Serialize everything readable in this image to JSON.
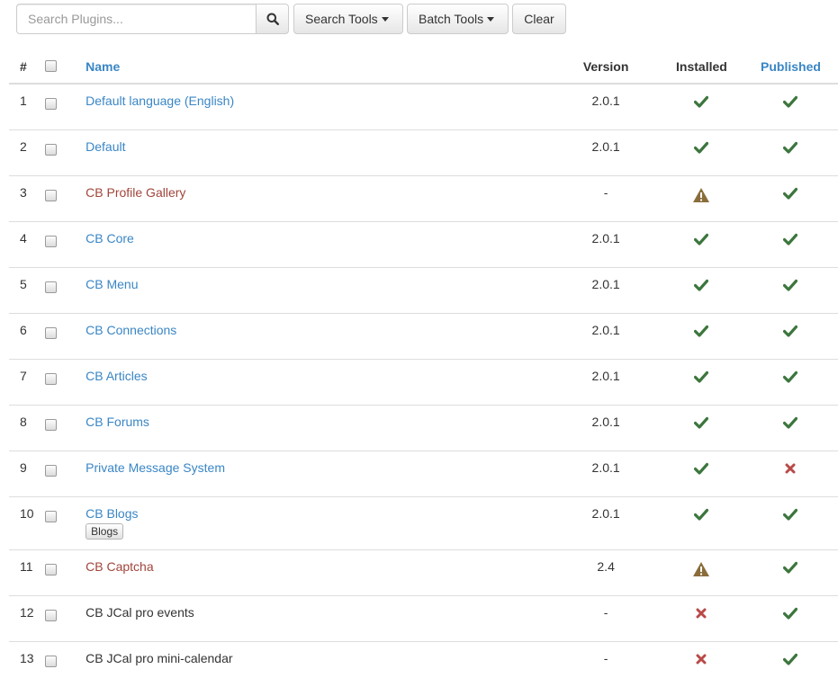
{
  "toolbar": {
    "search_placeholder": "Search Plugins...",
    "search_tools_label": "Search Tools",
    "batch_tools_label": "Batch Tools",
    "clear_label": "Clear"
  },
  "columns": {
    "num": "#",
    "name": "Name",
    "version": "Version",
    "installed": "Installed",
    "published": "Published"
  },
  "colors": {
    "link": "#3a86c5",
    "link_warning": "#a1453b",
    "check": "#3c763d",
    "cross": "#b94a48",
    "warning": "#8a6d3b"
  },
  "rows": [
    {
      "num": "1",
      "name": "Default language (English)",
      "name_style": "blue",
      "version": "2.0.1",
      "installed": "check",
      "published": "check"
    },
    {
      "num": "2",
      "name": "Default",
      "name_style": "blue",
      "version": "2.0.1",
      "installed": "check",
      "published": "check"
    },
    {
      "num": "3",
      "name": "CB Profile Gallery",
      "name_style": "red",
      "version": "-",
      "installed": "warning",
      "published": "check"
    },
    {
      "num": "4",
      "name": "CB Core",
      "name_style": "blue",
      "version": "2.0.1",
      "installed": "check",
      "published": "check"
    },
    {
      "num": "5",
      "name": "CB Menu",
      "name_style": "blue",
      "version": "2.0.1",
      "installed": "check",
      "published": "check"
    },
    {
      "num": "6",
      "name": "CB Connections",
      "name_style": "blue",
      "version": "2.0.1",
      "installed": "check",
      "published": "check"
    },
    {
      "num": "7",
      "name": "CB Articles",
      "name_style": "blue",
      "version": "2.0.1",
      "installed": "check",
      "published": "check"
    },
    {
      "num": "8",
      "name": "CB Forums",
      "name_style": "blue",
      "version": "2.0.1",
      "installed": "check",
      "published": "check"
    },
    {
      "num": "9",
      "name": "Private Message System",
      "name_style": "blue",
      "version": "2.0.1",
      "installed": "check",
      "published": "cross"
    },
    {
      "num": "10",
      "name": "CB Blogs",
      "name_style": "blue",
      "version": "2.0.1",
      "installed": "check",
      "published": "check",
      "tag": "Blogs"
    },
    {
      "num": "11",
      "name": "CB Captcha",
      "name_style": "red",
      "version": "2.4",
      "installed": "warning",
      "published": "check"
    },
    {
      "num": "12",
      "name": "CB JCal pro events",
      "name_style": "plain",
      "version": "-",
      "installed": "cross",
      "published": "check"
    },
    {
      "num": "13",
      "name": "CB JCal pro mini-calendar",
      "name_style": "plain",
      "version": "-",
      "installed": "cross",
      "published": "check"
    }
  ]
}
